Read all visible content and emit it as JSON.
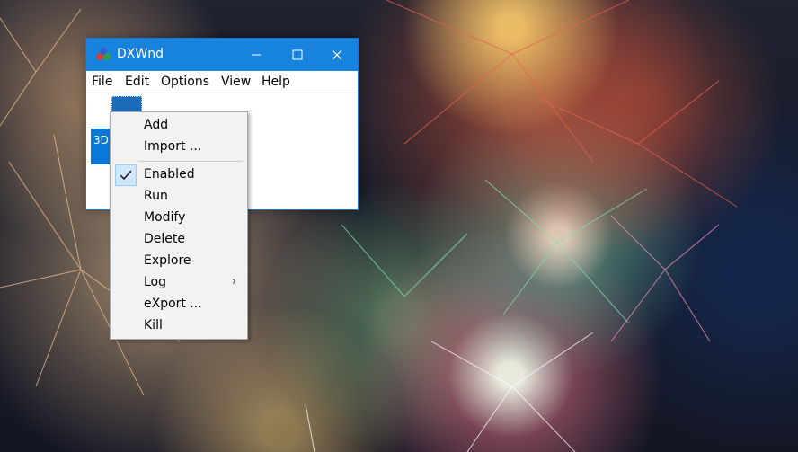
{
  "window": {
    "title": "DXWnd",
    "colors": {
      "titlebar": "#1783dc",
      "selection": "#0a78d7"
    }
  },
  "menubar": [
    "File",
    "Edit",
    "Options",
    "View",
    "Help"
  ],
  "list": {
    "selected_item_text": "3D"
  },
  "context_menu": {
    "items": [
      {
        "label": "Add"
      },
      {
        "label": "Import ..."
      },
      {
        "label": "Enabled",
        "checked": true
      },
      {
        "label": "Run"
      },
      {
        "label": "Modify"
      },
      {
        "label": "Delete"
      },
      {
        "label": "Explore"
      },
      {
        "label": "Log",
        "submenu": true
      },
      {
        "label": "eXport ..."
      },
      {
        "label": "Kill"
      }
    ]
  }
}
